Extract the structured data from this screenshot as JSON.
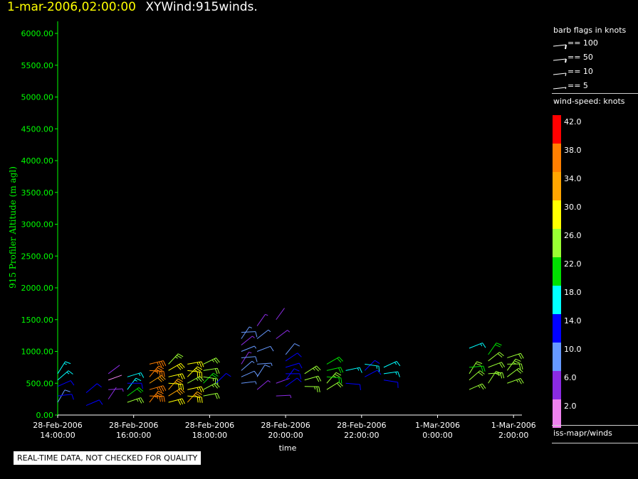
{
  "header": {
    "datetime": "1-mar-2006,02:00:00",
    "title": "XYWind:915winds."
  },
  "chart_data": {
    "type": "scatter",
    "subtype": "wind-barbs",
    "ylabel": "915 Profiler Altitude (m agl)",
    "xlabel": "time",
    "ylim": [
      0,
      6200
    ],
    "yticks": [
      "0.00",
      "500.00",
      "1000.00",
      "1500.00",
      "2000.00",
      "2500.00",
      "3000.00",
      "3500.00",
      "4000.00",
      "4500.00",
      "5000.00",
      "5500.00",
      "6000.00"
    ],
    "xlim_hours_since_first_tick": [
      0,
      12.6
    ],
    "xticks": [
      {
        "date": "28-Feb-2006",
        "time": "14:00:00"
      },
      {
        "date": "28-Feb-2006",
        "time": "16:00:00"
      },
      {
        "date": "28-Feb-2006",
        "time": "18:00:00"
      },
      {
        "date": "28-Feb-2006",
        "time": "20:00:00"
      },
      {
        "date": "28-Feb-2006",
        "time": "22:00:00"
      },
      {
        "date": "1-Mar-2006",
        "time": "0:00:00"
      },
      {
        "date": "1-Mar-2006",
        "time": "2:00:00"
      }
    ],
    "profiles": [
      {
        "time": "14:00",
        "altitudes": [
          200,
          300,
          450,
          550,
          650
        ],
        "speeds": [
          10,
          14,
          12,
          16,
          18
        ]
      },
      {
        "time": "14:45",
        "altitudes": [
          150,
          350
        ],
        "speeds": [
          14,
          12
        ]
      },
      {
        "time": "15:20",
        "altitudes": [
          250,
          400,
          550,
          650
        ],
        "speeds": [
          4,
          6,
          2,
          4
        ]
      },
      {
        "time": "15:50",
        "altitudes": [
          200,
          300,
          400,
          500,
          600
        ],
        "speeds": [
          26,
          22,
          18,
          14,
          18
        ]
      },
      {
        "time": "16:25",
        "altitudes": [
          200,
          300,
          400,
          500,
          600,
          700,
          800
        ],
        "speeds": [
          36,
          38,
          36,
          34,
          36,
          38,
          36
        ]
      },
      {
        "time": "16:55",
        "altitudes": [
          200,
          300,
          400,
          500,
          600,
          700,
          800
        ],
        "speeds": [
          30,
          34,
          32,
          30,
          28,
          30,
          26
        ]
      },
      {
        "time": "17:25",
        "altitudes": [
          200,
          300,
          400,
          500,
          600,
          700,
          800
        ],
        "speeds": [
          34,
          30,
          28,
          26,
          28,
          30,
          28
        ]
      },
      {
        "time": "17:50",
        "altitudes": [
          300,
          400,
          500,
          600,
          700,
          800
        ],
        "speeds": [
          24,
          26,
          22,
          26,
          24,
          26
        ]
      },
      {
        "time": "18:10",
        "altitudes": [
          500
        ],
        "speeds": [
          12
        ]
      },
      {
        "time": "18:50",
        "altitudes": [
          500,
          600,
          700,
          800,
          900,
          1000,
          1100,
          1200,
          1300
        ],
        "speeds": [
          8,
          10,
          8,
          6,
          10,
          8,
          6,
          8,
          10
        ]
      },
      {
        "time": "19:15",
        "altitudes": [
          400,
          600,
          800,
          1000,
          1200,
          1400
        ],
        "speeds": [
          6,
          10,
          8,
          10,
          8,
          6
        ]
      },
      {
        "time": "19:45",
        "altitudes": [
          300,
          500,
          1200,
          1500
        ],
        "speeds": [
          6,
          4,
          6,
          4
        ]
      },
      {
        "time": "20:00",
        "altitudes": [
          450,
          550,
          650,
          750,
          850,
          950
        ],
        "speeds": [
          14,
          12,
          14,
          12,
          14,
          10
        ]
      },
      {
        "time": "20:30",
        "altitudes": [
          450,
          550,
          650
        ],
        "speeds": [
          26,
          24,
          26
        ]
      },
      {
        "time": "21:05",
        "altitudes": [
          400,
          500,
          600,
          700,
          800
        ],
        "speeds": [
          24,
          26,
          22,
          20,
          22
        ]
      },
      {
        "time": "21:35",
        "altitudes": [
          500,
          700
        ],
        "speeds": [
          14,
          18
        ]
      },
      {
        "time": "22:05",
        "altitudes": [
          600,
          700,
          800
        ],
        "speeds": [
          14,
          12,
          16
        ]
      },
      {
        "time": "22:35",
        "altitudes": [
          550,
          650,
          750
        ],
        "speeds": [
          12,
          18,
          16
        ]
      },
      {
        "time": "0:50",
        "altitudes": [
          400,
          550,
          650,
          750,
          1050
        ],
        "speeds": [
          26,
          24,
          24,
          22,
          18
        ]
      },
      {
        "time": "1:20",
        "altitudes": [
          500,
          650,
          750,
          850,
          950
        ],
        "speeds": [
          24,
          26,
          24,
          24,
          22
        ]
      },
      {
        "time": "1:50",
        "altitudes": [
          500,
          600,
          700,
          800,
          900
        ],
        "speeds": [
          26,
          24,
          26,
          24,
          24
        ]
      }
    ]
  },
  "legend": {
    "barb_title": "barb flags in knots",
    "barb_items": [
      "== 100",
      "== 50",
      "== 10",
      "== 5"
    ],
    "speed_title": "wind-speed: knots",
    "speed_labels": [
      "42.0",
      "38.0",
      "34.0",
      "30.0",
      "26.0",
      "22.0",
      "18.0",
      "14.0",
      "10.0",
      "6.0",
      "2.0"
    ],
    "speed_colors": [
      "#ff0000",
      "#ff7f00",
      "#ffa500",
      "#ffff00",
      "#99ff33",
      "#00e000",
      "#00ffff",
      "#0000ff",
      "#6699ff",
      "#8a2be2",
      "#ee82ee"
    ],
    "source": "iss-mapr/winds"
  },
  "colors": {
    "axis": "#00ff00",
    "text": "#ffffff",
    "header_date": "#ffff00"
  },
  "notice": "REAL-TIME DATA, NOT CHECKED FOR QUALITY"
}
